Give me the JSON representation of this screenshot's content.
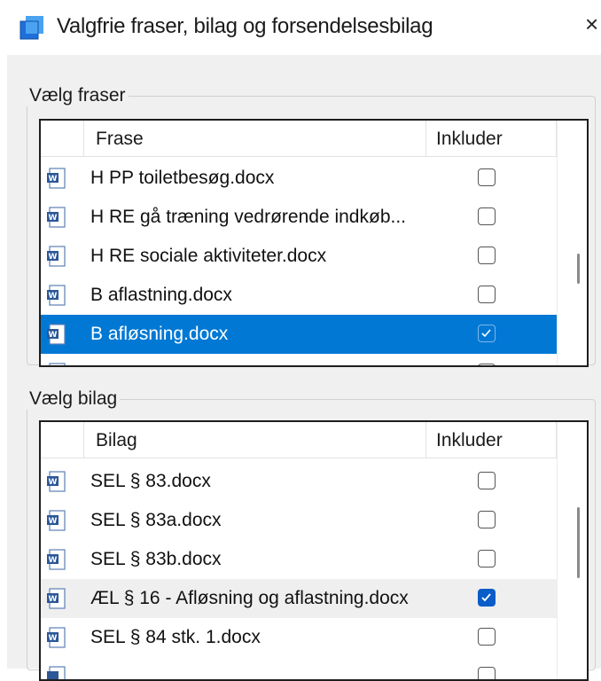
{
  "window": {
    "title": "Valgfrie fraser, bilag og forsendelsesbilag",
    "close_glyph": "×"
  },
  "fraser": {
    "group_label": "Vælg fraser",
    "col_name": "Frase",
    "col_include": "Inkluder",
    "rows": [
      {
        "label": "H PP toiletbesøg.docx",
        "included": false,
        "selected": false
      },
      {
        "label": "H RE gå træning vedrørende indkøb...",
        "included": false,
        "selected": false
      },
      {
        "label": "H RE sociale aktiviteter.docx",
        "included": false,
        "selected": false
      },
      {
        "label": "B aflastning.docx",
        "included": false,
        "selected": false
      },
      {
        "label": "B afløsning.docx",
        "included": true,
        "selected": true
      }
    ]
  },
  "bilag": {
    "group_label": "Vælg bilag",
    "col_name": "Bilag",
    "col_include": "Inkluder",
    "rows": [
      {
        "label": "SEL § 83.docx",
        "included": false,
        "selected": false
      },
      {
        "label": "SEL § 83a.docx",
        "included": false,
        "selected": false
      },
      {
        "label": "SEL § 83b.docx",
        "included": false,
        "selected": false
      },
      {
        "label": "ÆL § 16 - Afløsning og aflastning.docx",
        "included": true,
        "selected": false
      },
      {
        "label": "SEL § 84 stk. 1.docx",
        "included": false,
        "selected": false
      }
    ]
  },
  "icons": {
    "app": "app-window-icon",
    "row": "word-document-icon",
    "close": "close-icon",
    "check": "checkmark-icon"
  },
  "colors": {
    "selection": "#0078d4",
    "checked": "#0a5cc8",
    "app_icon": "#1e6fd9"
  }
}
